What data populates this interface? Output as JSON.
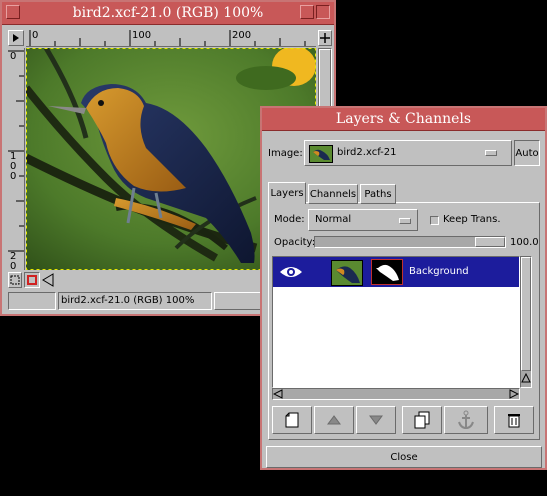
{
  "image_window": {
    "title": "bird2.xcf-21.0 (RGB) 100%",
    "ruler_top_ticks": [
      "0",
      "100",
      "200"
    ],
    "ruler_left_ticks": [
      "0",
      "1\n0\n0",
      "2\n0"
    ],
    "status_text": "bird2.xcf-21.0 (RGB) 100%"
  },
  "layers_dialog": {
    "title": "Layers & Channels",
    "image_label": "Image:",
    "image_value": "bird2.xcf-21",
    "auto_label": "Auto",
    "tabs": [
      {
        "label": "Layers"
      },
      {
        "label": "Channels"
      },
      {
        "label": "Paths"
      }
    ],
    "mode_label": "Mode:",
    "mode_value": "Normal",
    "keep_trans_label": "Keep Trans.",
    "opacity_label": "Opacity:",
    "opacity_value": "100.0",
    "opacity_level": 1.0,
    "layers": [
      {
        "name": "Background",
        "visible": true,
        "selected": true
      }
    ],
    "close_label": "Close"
  },
  "colors": {
    "title_bg": "#c85858",
    "window_bg": "#c0c0c0",
    "selection_bg": "#1c1c9c"
  }
}
